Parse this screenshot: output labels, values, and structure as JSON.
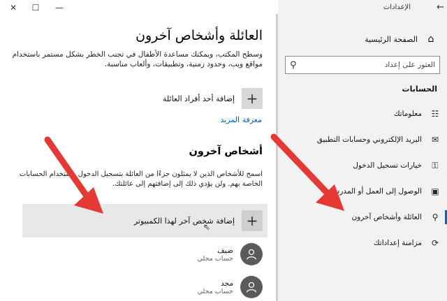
{
  "window": {
    "title": "الإعدادات",
    "back_glyph": "←",
    "minimize_glyph": "—",
    "maximize_glyph": "☐",
    "close_glyph": "✕"
  },
  "sidebar": {
    "home": "الصفحة الرئيسية",
    "search_placeholder": "العثور على إعداد",
    "heading": "الحسابات",
    "items": [
      {
        "label": "معلوماتك",
        "icon": "person-card-icon",
        "glyph": "☷"
      },
      {
        "label": "البريد الإلكتروني وحسابات التطبيق",
        "icon": "mail-icon",
        "glyph": "✉"
      },
      {
        "label": "خيارات تسجيل الدخول",
        "icon": "key-icon",
        "glyph": "⚿"
      },
      {
        "label": "الوصول إلى العمل أو المدرسة",
        "icon": "briefcase-icon",
        "glyph": "▣"
      },
      {
        "label": "العائلة وأشخاص آخرون",
        "icon": "person-icon",
        "glyph": "⚲"
      },
      {
        "label": "مزامنة إعداداتك",
        "icon": "sync-icon",
        "glyph": "⟳"
      }
    ],
    "active_index": 4
  },
  "main": {
    "title": "العائلة وأشخاص آخرون",
    "intro": "وسطح المكتب، ويمكنك مساعدة الأطفال في تجنب الخطر بشكل مستمر باستخدام مواقع ويب، وحدود زمنية، وتطبيقات، وألعاب مناسبة.",
    "add_family": "إضافة أحد أفراد العائلة",
    "learn_more": "معرفة المزيد",
    "others_title": "أشخاص آخرون",
    "others_desc": "اسمح للأشخاص الذين لا يمثلون جزءًا من العائلة بتسجيل الدخول باستخدام الحسابات الخاصة بهم. ولن يؤدي ذلك إلى إضافتهم إلى عائلتك.",
    "add_other": "إضافة شخص آخر لهذا الكمبيوتر",
    "plus_glyph": "+",
    "users": [
      {
        "name": "ضيف",
        "type": "حساب محلي"
      },
      {
        "name": "مجد",
        "type": "حساب محلي"
      }
    ]
  },
  "colors": {
    "accent": "#0067b8",
    "arrow": "#e53935",
    "sidebar_bg": "#f2f2f2"
  }
}
